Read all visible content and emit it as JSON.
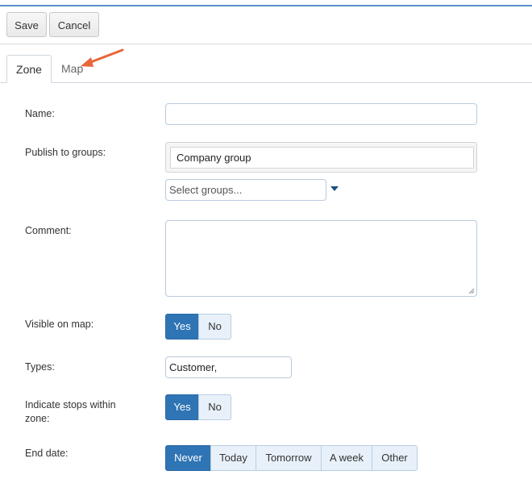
{
  "toolbar": {
    "save_label": "Save",
    "cancel_label": "Cancel"
  },
  "tabs": [
    {
      "label": "Zone",
      "active": true
    },
    {
      "label": "Map",
      "active": false
    }
  ],
  "annotation": {
    "arrow_color": "#e8673a"
  },
  "form": {
    "name": {
      "label": "Name:",
      "value": ""
    },
    "publish": {
      "label": "Publish to groups:",
      "selected_groups": [
        "Company group"
      ],
      "select_placeholder": "Select groups..."
    },
    "comment": {
      "label": "Comment:",
      "value": ""
    },
    "visible_on_map": {
      "label": "Visible on map:",
      "options": [
        "Yes",
        "No"
      ],
      "selected": "Yes"
    },
    "types": {
      "label": "Types:",
      "value": "Customer,"
    },
    "indicate_stops": {
      "label_line1": "Indicate stops within",
      "label_line2": "zone:",
      "options": [
        "Yes",
        "No"
      ],
      "selected": "Yes"
    },
    "end_date": {
      "label": "End date:",
      "options": [
        "Never",
        "Today",
        "Tomorrow",
        "A week",
        "Other"
      ],
      "selected": "Never"
    }
  },
  "colors": {
    "accent": "#2f74b4",
    "segment_bg": "#e8f1fa",
    "input_border": "#b9cadf",
    "top_line": "#5b8fc7"
  }
}
